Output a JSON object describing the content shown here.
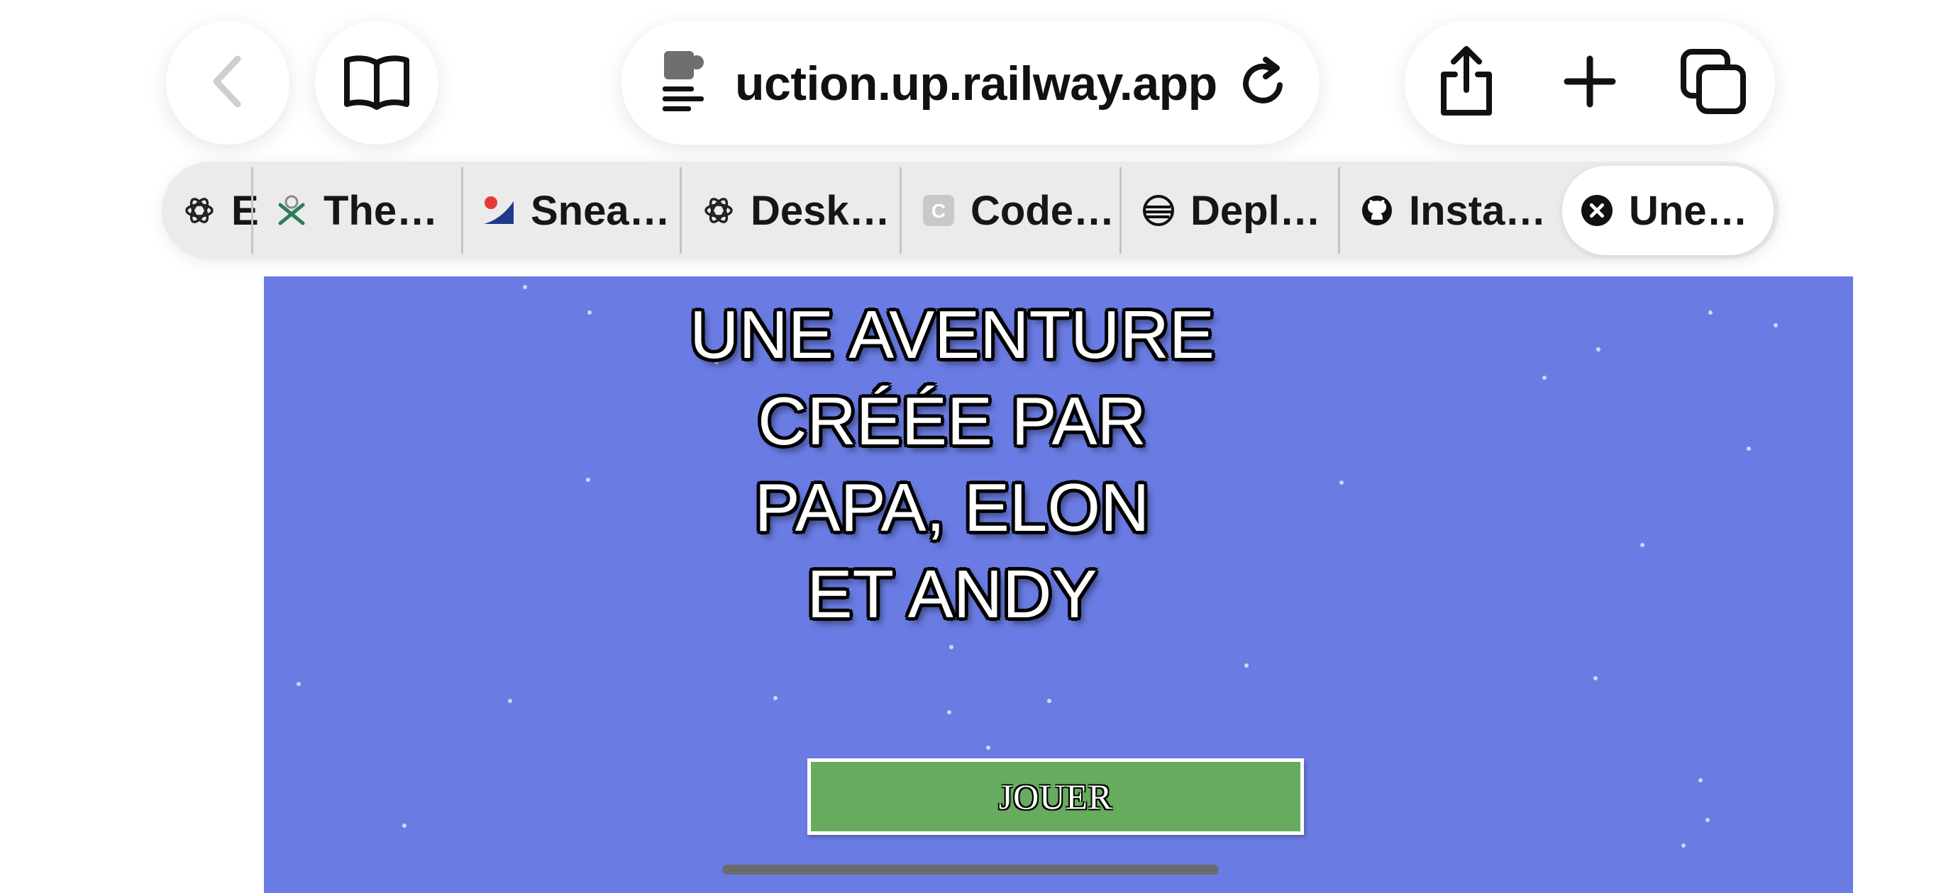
{
  "browser": {
    "url_display": "uction.up.railway.app",
    "tabs": [
      {
        "label": "E",
        "icon": "openai-icon"
      },
      {
        "label": "The…",
        "icon": "tool-icon"
      },
      {
        "label": "Snea…",
        "icon": "sneaker-site-icon"
      },
      {
        "label": "Desk…",
        "icon": "openai-icon"
      },
      {
        "label": "Code…",
        "icon": "codesandbox-c-icon"
      },
      {
        "label": "Depl…",
        "icon": "railway-icon"
      },
      {
        "label": "Insta…",
        "icon": "github-icon"
      },
      {
        "label": "Une…",
        "icon": "close-icon",
        "active": true
      }
    ]
  },
  "game": {
    "background_color": "#6a7ce3",
    "title_lines": [
      "UNE AVENTURE",
      "CRÉÉE PAR",
      "PAPA, ELON",
      "ET ANDY"
    ],
    "play_button_label": "JOUER",
    "play_button_color": "#67ab5e"
  }
}
